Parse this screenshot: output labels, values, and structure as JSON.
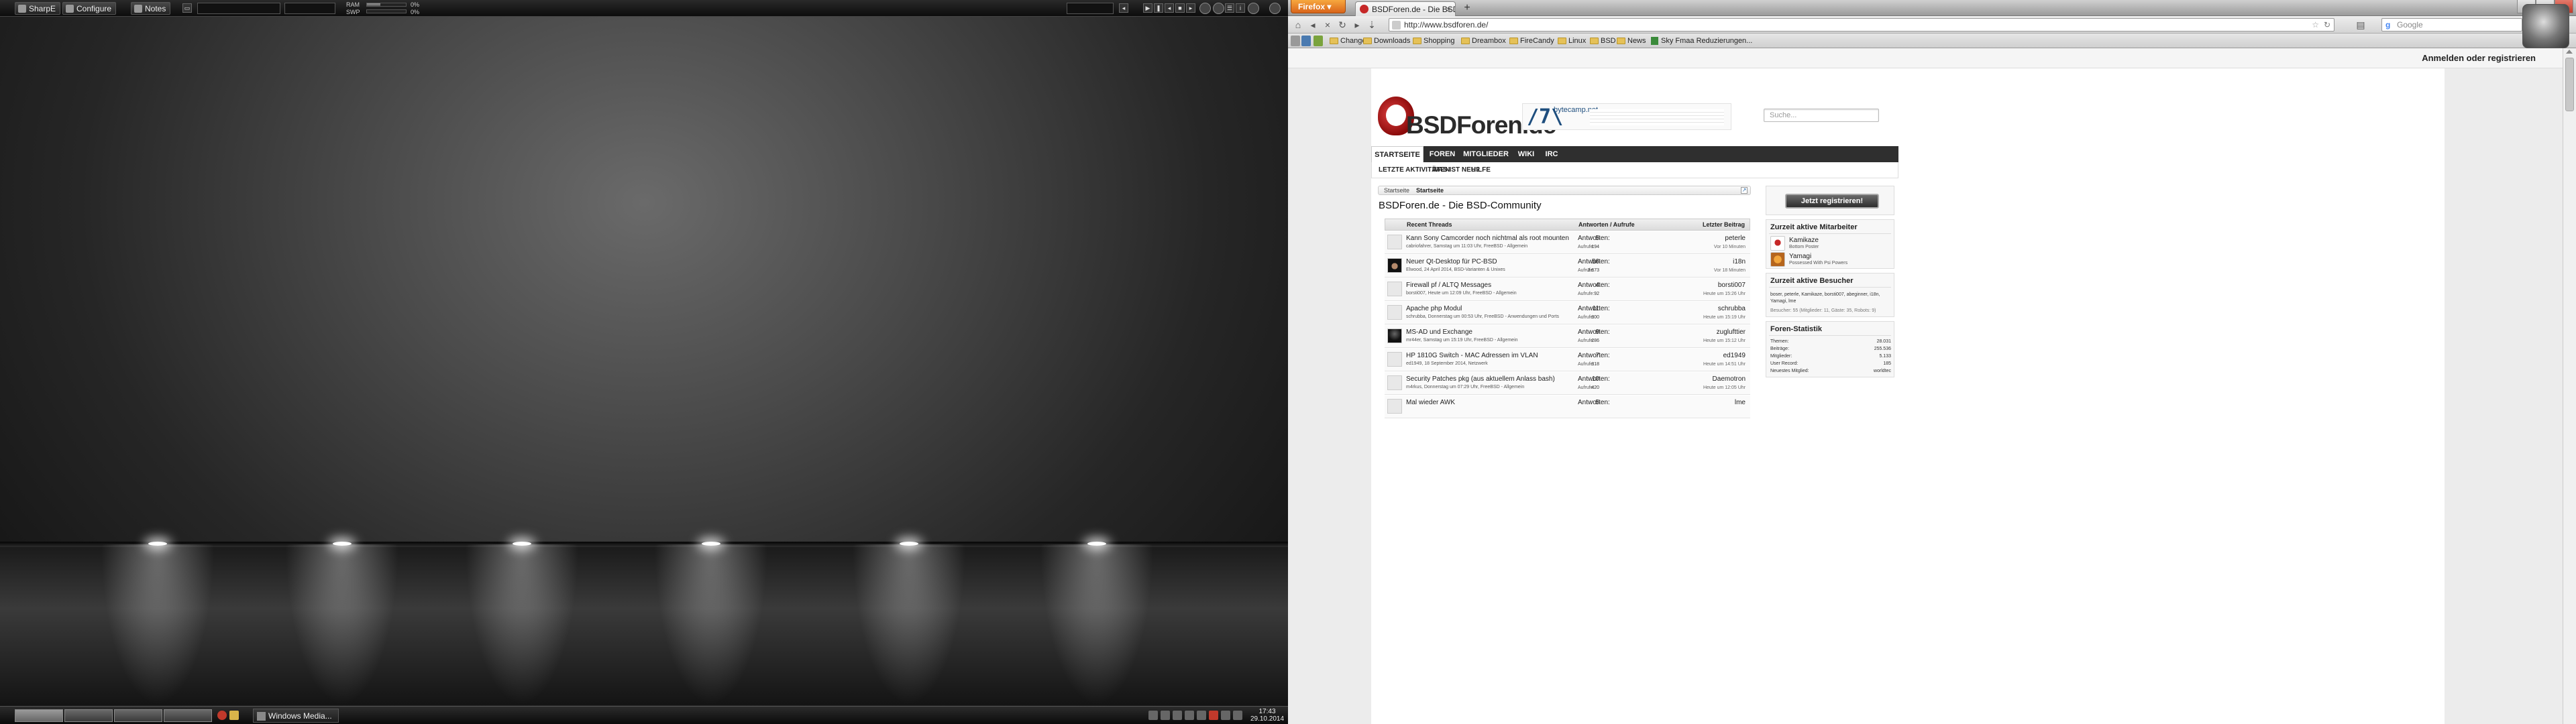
{
  "left_panel": {
    "buttons": [
      "SharpE",
      "Configure",
      "Notes"
    ],
    "ram_label": "RAM",
    "swp_label": "SWP",
    "ram_value": "0%",
    "swp_value": "0%",
    "ram_fraction": 0.35,
    "swp_fraction": 0.0
  },
  "taskbar": {
    "window_label": "Windows Media...",
    "clock_time": "17:43",
    "clock_date": "29.10.2014"
  },
  "firefox": {
    "menu_button": "Firefox",
    "tab_title": "BSDForen.de - Die BSD-Com...",
    "url": "http://www.bsdforen.de/",
    "search_placeholder": "Google",
    "bookmarks": [
      "Change",
      "Downloads",
      "Shopping",
      "Dreambox",
      "FireCandy",
      "Linux",
      "BSD",
      "News",
      "Sky Fmaa Reduzierungen..."
    ]
  },
  "page": {
    "login_link": "Anmelden oder registrieren",
    "logo_text": "BSDForen.de",
    "banner_text": "bytecamp.net",
    "search_placeholder": "Suche...",
    "main_nav": [
      "STARTSEITE",
      "FOREN",
      "MITGLIEDER",
      "WIKI",
      "IRC"
    ],
    "sub_nav": [
      "LETZTE AKTIVITÄTEN",
      "WAS IST NEU?",
      "HILFE"
    ],
    "breadcrumb": [
      "Startseite",
      "Startseite"
    ],
    "title": "BSDForen.de - Die BSD-Community",
    "thread_headers": {
      "threads": "Recent Threads",
      "replies": "Antworten / Aufrufe",
      "last": "Letzter Beitrag"
    },
    "answers_label": "Antworten:",
    "views_label": "Aufrufe:",
    "threads": [
      {
        "title": "Kann Sony Camcorder noch nichtmal als root mounten",
        "meta": "cabriofahrer, Samstag um 11:03 Uhr, FreeBSD - Allgemein",
        "answers": "5",
        "views": "194",
        "last_user": "peterle",
        "last_time": "Vor 10 Minuten",
        "avatar": "blank"
      },
      {
        "title": "Neuer Qt-Desktop für PC-BSD",
        "meta": "Elwood, 24 April 2014, BSD-Varianten & Unixes",
        "answers": "56",
        "views": "3.673",
        "last_user": "i18n",
        "last_time": "Vor 18 Minuten",
        "avatar": "hat"
      },
      {
        "title": "Firewall pf / ALTQ Messages",
        "meta": "borsti007, Heute um 12:09 Uhr, FreeBSD - Allgemein",
        "answers": "4",
        "views": "92",
        "last_user": "borsti007",
        "last_time": "Heute um 15:26 Uhr",
        "avatar": "blank"
      },
      {
        "title": "Apache php Modul",
        "meta": "schrubba, Donnerstag um 00:53 Uhr, FreeBSD - Anwendungen und Ports",
        "answers": "11",
        "views": "300",
        "last_user": "schrubba",
        "last_time": "Heute um 15:19 Uhr",
        "avatar": "blank"
      },
      {
        "title": "MS-AD und Exchange",
        "meta": "mr44er, Samstag um 15:19 Uhr, FreeBSD - Allgemein",
        "answers": "9",
        "views": "286",
        "last_user": "zuglufttier",
        "last_time": "Heute um 15:12 Uhr",
        "avatar": "dark"
      },
      {
        "title": "HP 1810G Switch - MAC Adressen im VLAN",
        "meta": "ed1949, 18 September 2014, Netzwerk",
        "answers": "7",
        "views": "318",
        "last_user": "ed1949",
        "last_time": "Heute um 14:51 Uhr",
        "avatar": "blank"
      },
      {
        "title": "Security Patches pkg (aus aktuellem Anlass bash)",
        "meta": "m4rkus, Donnerstag um 07:29 Uhr, FreeBSD - Allgemein",
        "answers": "10",
        "views": "420",
        "last_user": "Daemotron",
        "last_time": "Heute um 12:05 Uhr",
        "avatar": "blank"
      },
      {
        "title": "Mal wieder AWK",
        "meta": "",
        "answers": "5",
        "views": "",
        "last_user": "lme",
        "last_time": "",
        "avatar": "blank"
      }
    ],
    "register_button": "Jetzt registrieren!",
    "active_members_title": "Zurzeit aktive Mitarbeiter",
    "active_members": [
      {
        "name": "Kamikaze",
        "title": "Bottom Poster"
      },
      {
        "name": "Yamagi",
        "title": "Possessed With Psi Powers"
      }
    ],
    "active_visitors_title": "Zurzeit aktive Besucher",
    "active_visitors": "boser, peterle, Kamikaze, borsti007, abeginner, i18n, Yamagi, lme",
    "visitor_count": "Besucher: 55 (Mitglieder: 11, Gäste: 35, Robots: 9)",
    "stats_title": "Foren-Statistik",
    "stats": [
      {
        "label": "Themen:",
        "value": "28.031"
      },
      {
        "label": "Beiträge:",
        "value": "255.536"
      },
      {
        "label": "Mitglieder:",
        "value": "5.133"
      },
      {
        "label": "User Record:",
        "value": "185"
      },
      {
        "label": "Neuestes Mitglied:",
        "value": "worldtec"
      }
    ]
  },
  "colors": {
    "nav_bg": "#2f2f2f",
    "firefox_orange": "#e67a22",
    "logo_red": "#b01818"
  }
}
